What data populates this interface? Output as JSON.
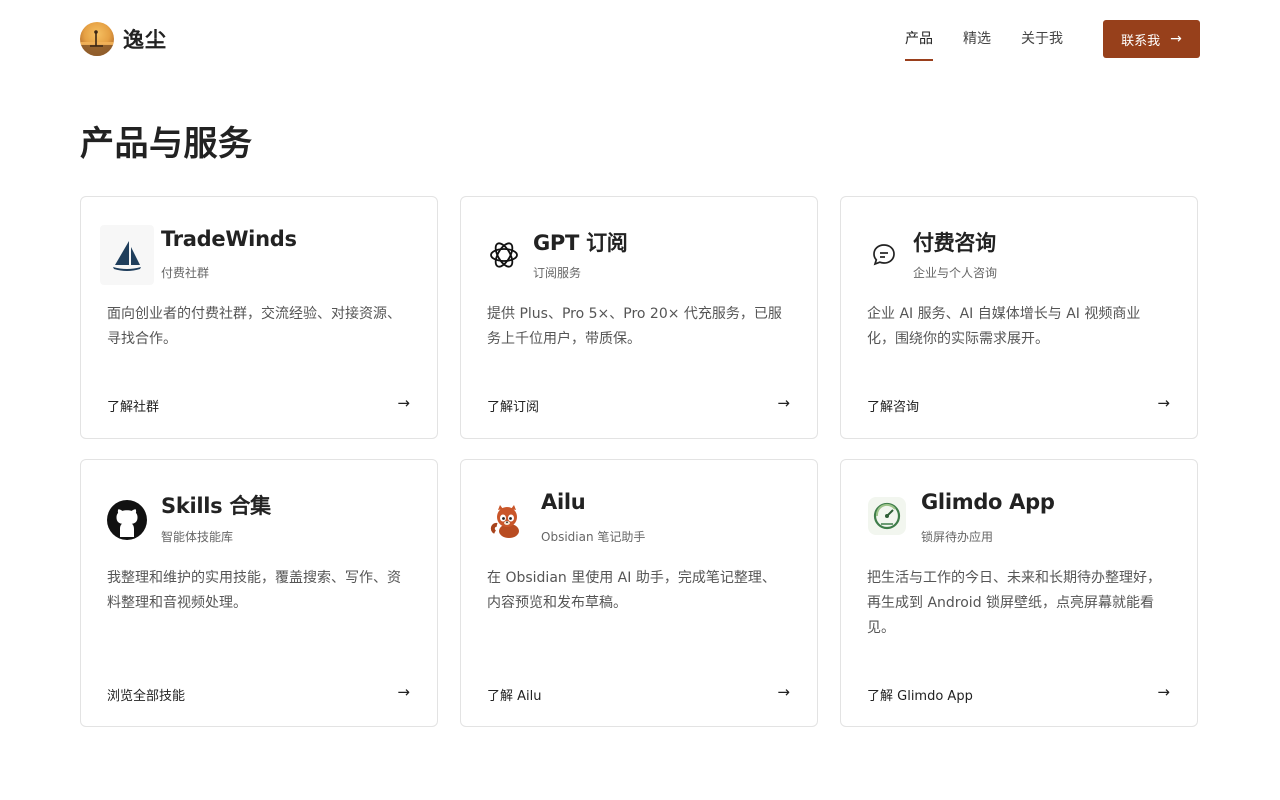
{
  "brand": {
    "name": "逸尘",
    "avatar_icon": "sunset-surfer-avatar"
  },
  "nav": {
    "items": [
      {
        "label": "产品",
        "active": true
      },
      {
        "label": "精选",
        "active": false
      },
      {
        "label": "关于我",
        "active": false
      }
    ],
    "contact_label": "联系我",
    "contact_icon": "arrow-right-icon"
  },
  "page_title": "产品与服务",
  "colors": {
    "accent": "#97401b",
    "card_border": "#e3e3e3"
  },
  "cards": [
    {
      "icon": "sailboat-icon",
      "title": "TradeWinds",
      "subtitle": "付费社群",
      "description": "面向创业者的付费社群，交流经验、对接资源、寻找合作。",
      "link": "了解社群"
    },
    {
      "icon": "openai-icon",
      "title": "GPT 订阅",
      "subtitle": "订阅服务",
      "description": "提供 Plus、Pro 5×、Pro 20× 代充服务，已服务上千位用户，带质保。",
      "link": "了解订阅"
    },
    {
      "icon": "chat-bubble-icon",
      "title": "付费咨询",
      "subtitle": "企业与个人咨询",
      "description": "企业 AI 服务、AI 自媒体增长与 AI 视频商业化，围绕你的实际需求展开。",
      "link": "了解咨询"
    },
    {
      "icon": "github-icon",
      "title": "Skills 合集",
      "subtitle": "智能体技能库",
      "description": "我整理和维护的实用技能，覆盖搜索、写作、资料整理和音视频处理。",
      "link": "浏览全部技能"
    },
    {
      "icon": "red-panda-icon",
      "title": "Ailu",
      "subtitle": "Obsidian 笔记助手",
      "description": "在 Obsidian 里使用 AI 助手，完成笔记整理、内容预览和发布草稿。",
      "link": "了解 Ailu"
    },
    {
      "icon": "glimdo-gauge-icon",
      "title": "Glimdo App",
      "subtitle": "锁屏待办应用",
      "description": "把生活与工作的今日、未来和长期待办整理好，再生成到 Android 锁屏壁纸，点亮屏幕就能看见。",
      "link": "了解 Glimdo App"
    }
  ]
}
